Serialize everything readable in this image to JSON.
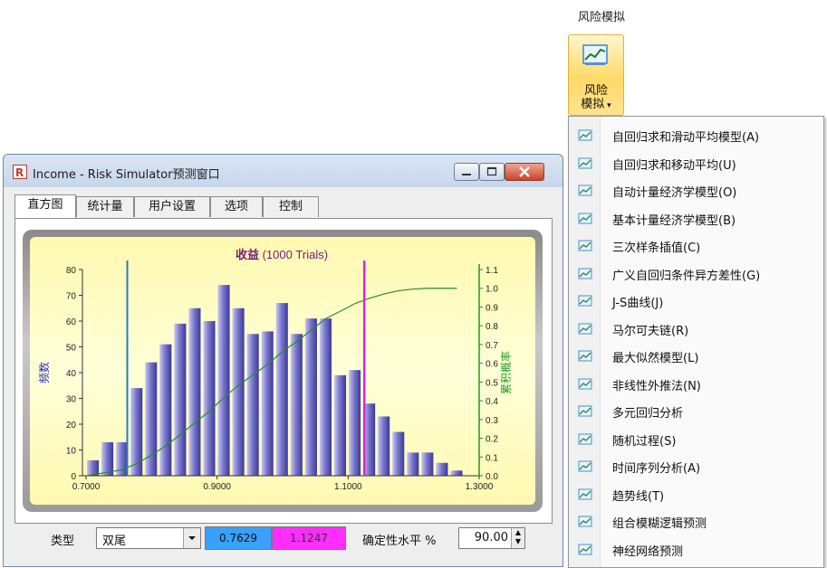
{
  "ribbon": {
    "group_title": "风险模拟",
    "button_line1": "风险",
    "button_line2": "模拟"
  },
  "menu": {
    "items": [
      "自回归求和滑动平均模型(A)",
      "自回归求和移动平均(U)",
      "自动计量经济学模型(O)",
      "基本计量经济学模型(B)",
      "三次样条插值(C)",
      "广义自回归条件异方差性(G)",
      "J-S曲线(J)",
      "马尔可夫链(R)",
      "最大似然模型(L)",
      "非线性外推法(N)",
      "多元回归分析",
      "随机过程(S)",
      "时间序列分析(A)",
      "趋势线(T)",
      "组合模糊逻辑预测",
      "神经网络预测"
    ]
  },
  "window": {
    "title": "Income - Risk Simulator预测窗口",
    "tabs": [
      "直方图",
      "统计量",
      "用户设置",
      "选项",
      "控制"
    ],
    "active_tab": "直方图"
  },
  "chart_data": {
    "type": "bar",
    "title": "收益 (1000 Trials)",
    "title_main": "收益",
    "title_suffix": "(1000 Trials)",
    "ylabel": "频数",
    "y2label": "累积概率",
    "x_ticks": [
      "0.7000",
      "0.9000",
      "1.1000",
      "1.3000"
    ],
    "x_range": [
      0.7,
      1.3
    ],
    "y_ticks": [
      "0",
      "10",
      "20",
      "30",
      "40",
      "50",
      "60",
      "70",
      "80"
    ],
    "ylim": [
      0,
      80
    ],
    "y2_ticks": [
      "0.0",
      "0.1",
      "0.2",
      "0.3",
      "0.4",
      "0.5",
      "0.6",
      "0.7",
      "0.8",
      "0.9",
      "1.0",
      "1.1"
    ],
    "y2lim": [
      0,
      1.1
    ],
    "bin_width": 0.0222,
    "bins_start": 0.7,
    "values": [
      6,
      13,
      13,
      34,
      44,
      51,
      59,
      65,
      60,
      74,
      65,
      55,
      56,
      67,
      55,
      61,
      61,
      39,
      41,
      28,
      23,
      17,
      9,
      9,
      5,
      2
    ],
    "cumulative": [
      0.006,
      0.019,
      0.032,
      0.066,
      0.11,
      0.161,
      0.22,
      0.285,
      0.345,
      0.419,
      0.484,
      0.539,
      0.595,
      0.662,
      0.717,
      0.778,
      0.839,
      0.878,
      0.919,
      0.947,
      0.97,
      0.987,
      0.996,
      1.0,
      1.0,
      1.0
    ],
    "lower_marker": 0.7629,
    "upper_marker": 1.1247,
    "colors": {
      "bar": "#5a58b8",
      "cumulative": "#2a8a2a",
      "lower_line": "#1f7fbf",
      "upper_line": "#e020e0",
      "title": "#7a1a7a",
      "y2axis": "#1f9a1f"
    },
    "grid": false
  },
  "controls": {
    "type_label": "类型",
    "type_value": "双尾",
    "lower_value": "0.7629",
    "upper_value": "1.1247",
    "certainty_label": "确定性水平 %",
    "certainty_value": "90.00"
  }
}
